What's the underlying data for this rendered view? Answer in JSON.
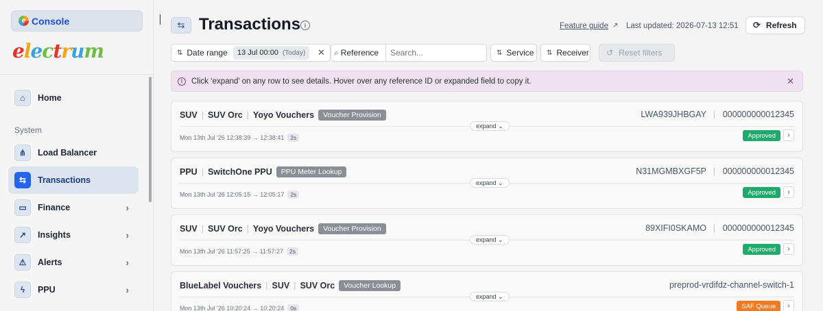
{
  "sidebar": {
    "console_label": "Console",
    "brand": "electrum",
    "section_label": "System",
    "items": [
      {
        "label": "Home",
        "icon": "home-icon"
      },
      {
        "label": "Load Balancer",
        "icon": "network-icon"
      },
      {
        "label": "Transactions",
        "icon": "transfer-icon",
        "active": true
      },
      {
        "label": "Finance",
        "icon": "money-icon"
      },
      {
        "label": "Insights",
        "icon": "chart-icon"
      },
      {
        "label": "Alerts",
        "icon": "warning-icon"
      },
      {
        "label": "PPU",
        "icon": "lightning-icon"
      }
    ]
  },
  "header": {
    "title": "Transactions",
    "feature_guide": "Feature guide",
    "last_updated": "Last updated: 2026-07-13 12:51",
    "refresh_label": "Refresh"
  },
  "filters": {
    "date_range_label": "Date range",
    "date_value": "13 Jul 00:00",
    "date_hint": "(Today)",
    "reference_label": "Reference",
    "search_placeholder": "Search...",
    "service_label": "Service",
    "receiver_label": "Receiver",
    "reset_label": "Reset filters"
  },
  "banner": {
    "text": "Click ‘expand’ on any row to see details. Hover over any reference ID or expanded field to copy it."
  },
  "transactions": [
    {
      "path": [
        "SUV",
        "SUV Orc",
        "Yoyo Vouchers"
      ],
      "tag": "Voucher Provision",
      "reference": "LWA939JHBGAY",
      "account": "000000000012345",
      "time": "Mon 13th Jul '26 12:38:39 → 12:38:41",
      "duration": "2s",
      "status": "Approved",
      "expand": "expand"
    },
    {
      "path": [
        "PPU",
        "SwitchOne PPU"
      ],
      "tag": "PPU Meter Lookup",
      "reference": "N31MGMBXGF5P",
      "account": "000000000012345",
      "time": "Mon 13th Jul '26 12:05:15 → 12:05:17",
      "duration": "2s",
      "status": "Approved",
      "expand": "expand"
    },
    {
      "path": [
        "SUV",
        "SUV Orc",
        "Yoyo Vouchers"
      ],
      "tag": "Voucher Provision",
      "reference": "89XIFI0SKAMO",
      "account": "000000000012345",
      "time": "Mon 13th Jul '26 11:57:25 → 11:57:27",
      "duration": "2s",
      "status": "Approved",
      "expand": "expand"
    },
    {
      "path": [
        "BlueLabel Vouchers",
        "SUV",
        "SUV Orc"
      ],
      "tag": "Voucher Lookup",
      "reference": "preprod-vrdifdz-channel-switch-1",
      "time": "Mon 13th Jul '26 10:20:24 → 10:20:24",
      "duration": "0s",
      "status": "SAF Queue",
      "expand": "expand"
    }
  ],
  "colors": {
    "approved": "#1faa6b",
    "saf_queue": "#f07a22",
    "accent": "#2563eb",
    "banner_bg": "#efe2ef"
  }
}
